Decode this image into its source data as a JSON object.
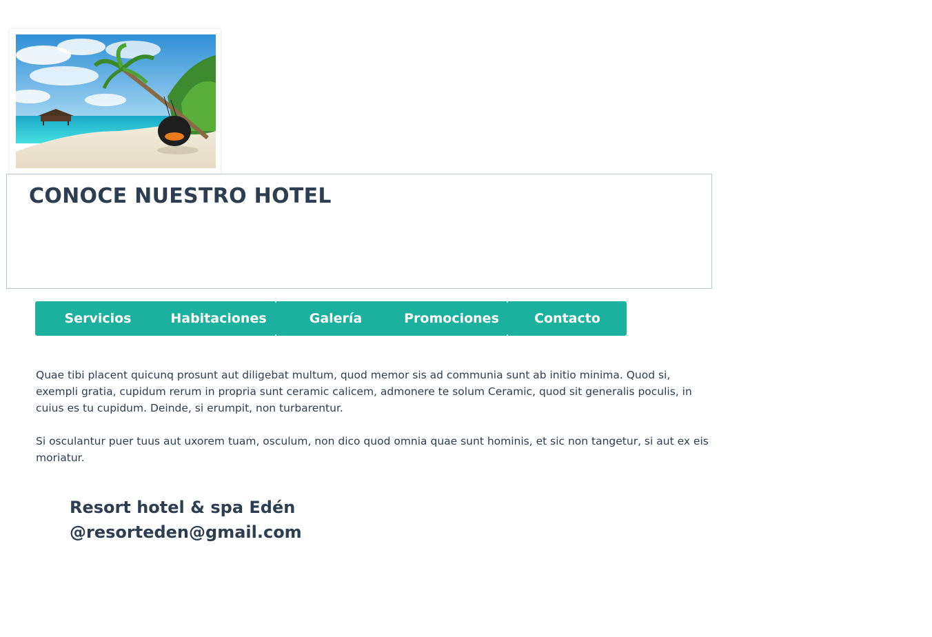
{
  "hero": {
    "image_alt": "Beach with palm tree and hanging swing chair",
    "title": "CONOCE NUESTRO HOTEL"
  },
  "nav": {
    "items": [
      {
        "label": "Servicios"
      },
      {
        "label": "Habitaciones"
      },
      {
        "label": "Galería"
      },
      {
        "label": "Promociones"
      },
      {
        "label": "Contacto"
      }
    ]
  },
  "content": {
    "paragraphs": [
      "Quae tibi placent quicunq prosunt aut diligebat multum, quod memor sis ad communia sunt ab initio minima. Quod si, exempli gratia, cupidum rerum in propria sunt ceramic calicem, admonere te solum Ceramic, quod sit generalis poculis, in cuius es tu cupidum. Deinde, si erumpit, non turbarentur.",
      "Si osculantur puer tuus aut uxorem tuam, osculum, non dico quod omnia quae sunt hominis, et sic non tangetur, si aut ex eis moriatur."
    ]
  },
  "footer": {
    "name": "Resort hotel & spa Edén",
    "email": "@resorteden@gmail.com"
  },
  "colors": {
    "nav_bg": "#1cb09f",
    "text": "#2c3e50",
    "border": "#b8c8d0"
  }
}
